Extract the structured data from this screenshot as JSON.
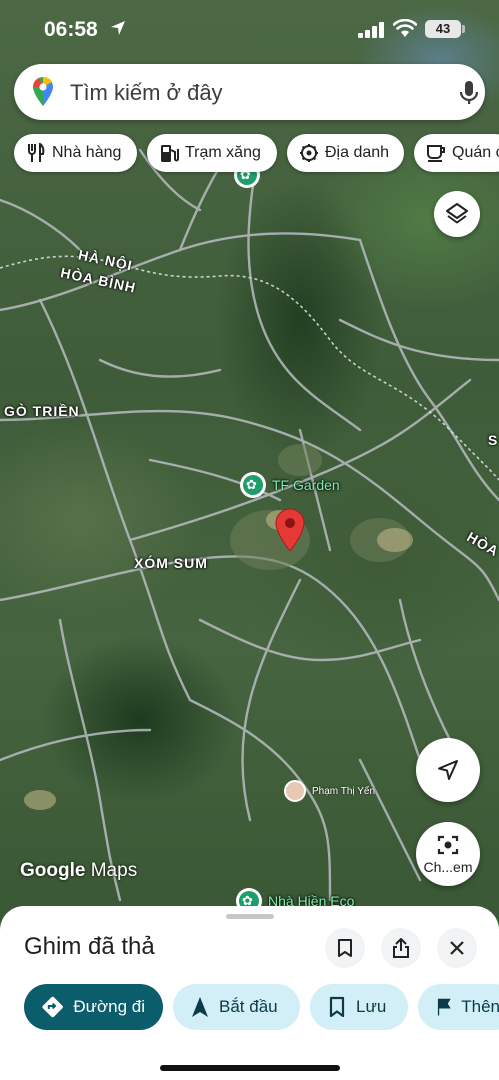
{
  "status_bar": {
    "time": "06:58",
    "battery": "43"
  },
  "search": {
    "placeholder": "Tìm kiếm ở đây"
  },
  "chips": [
    {
      "label": "Nhà hàng",
      "icon": "restaurant-icon"
    },
    {
      "label": "Trạm xăng",
      "icon": "gas-station-icon"
    },
    {
      "label": "Địa danh",
      "icon": "landmark-icon"
    },
    {
      "label": "Quán c",
      "icon": "coffee-icon"
    }
  ],
  "map": {
    "labels": {
      "ha_noi": "HÀ NỘI",
      "hoa_binh": "HÒA BÌNH",
      "go_trien": "GÒ TRIỀN",
      "xom_sum": "XÓM SUM",
      "hoa_right": "HÒA",
      "s_right": "S"
    },
    "pois": {
      "tf_garden": "TF Garden",
      "nha_hien": "Nhà Hiền Eco"
    },
    "user_tag": "Phạm Thị Yến",
    "pin_color": "#e53935",
    "poi_color": "#1e9e6a"
  },
  "fabs": {
    "lens_label": "Ch...em"
  },
  "google_logo": {
    "brand": "Google",
    "product": "Maps"
  },
  "sheet": {
    "title": "Ghim đã thả",
    "actions": {
      "directions": "Đường đi",
      "start": "Bắt đầu",
      "save": "Lưu",
      "more": "Thên"
    },
    "primary_color": "#0b5d6b",
    "secondary_color": "#d2eef6"
  }
}
